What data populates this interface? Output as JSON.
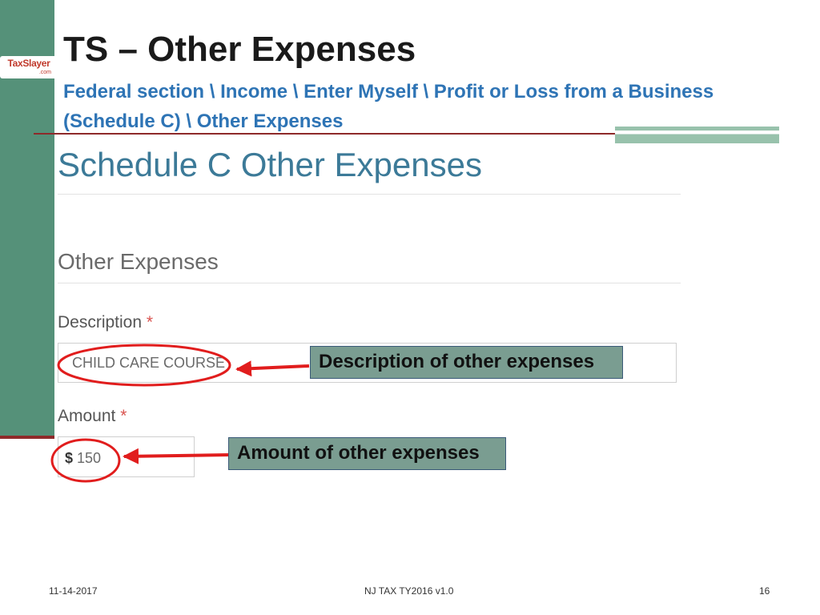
{
  "logo": {
    "main": "TaxSlayer",
    "sub": ".com"
  },
  "header": {
    "title": "TS – Other Expenses",
    "breadcrumb": "Federal section \\ Income \\ Enter Myself \\ Profit or Loss from a Business (Schedule C) \\ Other Expenses"
  },
  "form": {
    "title": "Schedule C Other Expenses",
    "section_title": "Other Expenses",
    "description": {
      "label": "Description",
      "required_mark": "*",
      "value": "CHILD CARE COURSE"
    },
    "amount": {
      "label": "Amount",
      "required_mark": "*",
      "currency_symbol": "$",
      "value": "150"
    }
  },
  "annotations": {
    "description_callout": "Description of other expenses",
    "amount_callout": "Amount of other expenses"
  },
  "footer": {
    "date": "11-14-2017",
    "center": "NJ TAX TY2016 v1.0",
    "page_number": "16"
  },
  "colors": {
    "sidebar": "#559179",
    "divider": "#8e2a2a",
    "breadcrumb": "#2e74b5",
    "form_title": "#3c7a98",
    "callout_fill": "#7a9d91",
    "annotation_red": "#e11d1d",
    "required_star": "#d9534f"
  },
  "icons": {
    "logo": "taxslayer-logo",
    "annotation_arrow": "arrow-left-icon",
    "annotation_circle": "circle-highlight"
  }
}
